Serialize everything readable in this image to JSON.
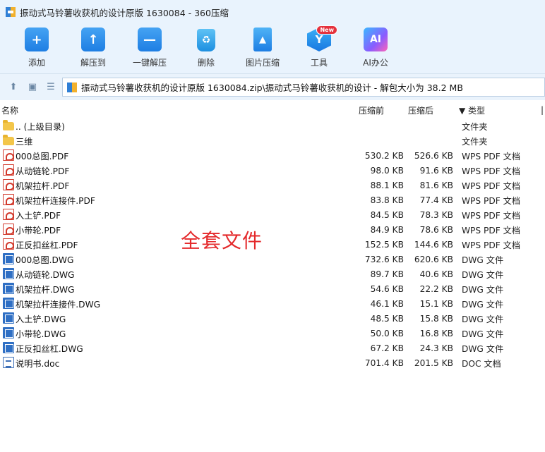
{
  "window": {
    "title": "振动式马铃薯收获机的设计原版 1630084 - 360压缩"
  },
  "toolbar": {
    "items": [
      {
        "label": "添加",
        "icon": "add-icon"
      },
      {
        "label": "解压到",
        "icon": "extract-to-icon"
      },
      {
        "label": "一键解压",
        "icon": "one-click-extract-icon"
      },
      {
        "label": "删除",
        "icon": "delete-icon"
      },
      {
        "label": "图片压缩",
        "icon": "image-compress-icon"
      },
      {
        "label": "工具",
        "icon": "tools-icon",
        "badge": "New"
      },
      {
        "label": "AI办公",
        "icon": "ai-office-icon",
        "glyph": "AI"
      }
    ]
  },
  "address": {
    "path": "振动式马铃薯收获机的设计原版 1630084.zip\\振动式马铃薯收获机的设计 - 解包大小为 38.2 MB"
  },
  "columns": {
    "name": "名称",
    "packed": "压缩前",
    "size": "压缩后",
    "type": "类型"
  },
  "files": [
    {
      "name": ".. (上级目录)",
      "packed": "",
      "size": "",
      "type": "文件夹",
      "kind": "folder"
    },
    {
      "name": "三维",
      "packed": "",
      "size": "",
      "type": "文件夹",
      "kind": "folder"
    },
    {
      "name": "000总图.PDF",
      "packed": "530.2 KB",
      "size": "526.6 KB",
      "type": "WPS PDF 文档",
      "kind": "pdf"
    },
    {
      "name": "从动链轮.PDF",
      "packed": "98.0 KB",
      "size": "91.6 KB",
      "type": "WPS PDF 文档",
      "kind": "pdf"
    },
    {
      "name": "机架拉杆.PDF",
      "packed": "88.1 KB",
      "size": "81.6 KB",
      "type": "WPS PDF 文档",
      "kind": "pdf"
    },
    {
      "name": "机架拉杆连接件.PDF",
      "packed": "83.8 KB",
      "size": "77.4 KB",
      "type": "WPS PDF 文档",
      "kind": "pdf"
    },
    {
      "name": "入土铲.PDF",
      "packed": "84.5 KB",
      "size": "78.3 KB",
      "type": "WPS PDF 文档",
      "kind": "pdf"
    },
    {
      "name": "小带轮.PDF",
      "packed": "84.9 KB",
      "size": "78.6 KB",
      "type": "WPS PDF 文档",
      "kind": "pdf"
    },
    {
      "name": "正反扣丝杠.PDF",
      "packed": "152.5 KB",
      "size": "144.6 KB",
      "type": "WPS PDF 文档",
      "kind": "pdf"
    },
    {
      "name": "000总图.DWG",
      "packed": "732.6 KB",
      "size": "620.6 KB",
      "type": "DWG 文件",
      "kind": "dwg"
    },
    {
      "name": "从动链轮.DWG",
      "packed": "89.7 KB",
      "size": "40.6 KB",
      "type": "DWG 文件",
      "kind": "dwg"
    },
    {
      "name": "机架拉杆.DWG",
      "packed": "54.6 KB",
      "size": "22.2 KB",
      "type": "DWG 文件",
      "kind": "dwg"
    },
    {
      "name": "机架拉杆连接件.DWG",
      "packed": "46.1 KB",
      "size": "15.1 KB",
      "type": "DWG 文件",
      "kind": "dwg"
    },
    {
      "name": "入土铲.DWG",
      "packed": "48.5 KB",
      "size": "15.8 KB",
      "type": "DWG 文件",
      "kind": "dwg"
    },
    {
      "name": "小带轮.DWG",
      "packed": "50.0 KB",
      "size": "16.8 KB",
      "type": "DWG 文件",
      "kind": "dwg"
    },
    {
      "name": "正反扣丝杠.DWG",
      "packed": "67.2 KB",
      "size": "24.3 KB",
      "type": "DWG 文件",
      "kind": "dwg"
    },
    {
      "name": "说明书.doc",
      "packed": "701.4 KB",
      "size": "201.5 KB",
      "type": "DOC 文档",
      "kind": "doc"
    }
  ],
  "watermark": "全套文件",
  "colors": {
    "toolbar_bg": "#e9f3fd",
    "accent": "#1e7ee3",
    "watermark": "#e4292b"
  }
}
